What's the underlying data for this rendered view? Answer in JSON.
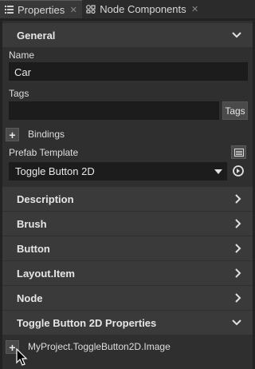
{
  "tabs": [
    {
      "label": "Properties",
      "icon": "list-icon",
      "active": true
    },
    {
      "label": "Node Components",
      "icon": "components-icon",
      "active": false
    }
  ],
  "general": {
    "header": "General",
    "name_label": "Name",
    "name_value": "Car",
    "tags_label": "Tags",
    "tags_value": "",
    "tags_button": "Tags",
    "bindings_label": "Bindings",
    "prefab_label": "Prefab Template",
    "prefab_value": "Toggle Button 2D"
  },
  "sections": [
    {
      "label": "Description",
      "expanded": false
    },
    {
      "label": "Brush",
      "expanded": false
    },
    {
      "label": "Button",
      "expanded": false
    },
    {
      "label": "Layout.Item",
      "expanded": false
    },
    {
      "label": "Node",
      "expanded": false
    },
    {
      "label": "Toggle Button 2D Properties",
      "expanded": true
    }
  ],
  "toggle_props": {
    "add_property_label": "MyProject.ToggleButton2D.Image"
  }
}
